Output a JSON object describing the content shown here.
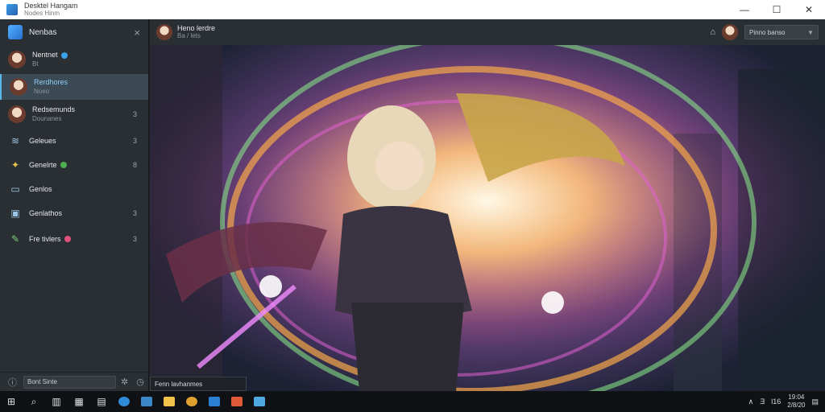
{
  "window": {
    "title": "Desktel Hangam",
    "subtitle": "Nodes   Hinm",
    "minimize_icon": "minimize-icon",
    "maximize_icon": "maximize-icon",
    "close_icon": "close-icon"
  },
  "sidebar": {
    "title": "Nenbas",
    "close_label": "×",
    "items": [
      {
        "label": "Nentnet",
        "sub": "Bt",
        "icon": "avatar",
        "badge_color": "#3aa0e8",
        "count": ""
      },
      {
        "label": "Rerdhores",
        "sub": "Noeo",
        "icon": "avatar",
        "badge_color": "",
        "count": "",
        "active": true
      },
      {
        "label": "Redsemunds",
        "sub": "Dounanes",
        "icon": "avatar",
        "badge_color": "",
        "count": "3"
      },
      {
        "label": "Geleues",
        "sub": "",
        "icon": "layers-icon",
        "badge_color": "",
        "count": "3"
      },
      {
        "label": "Genelrte",
        "sub": "",
        "icon": "puzzle-icon",
        "badge_color": "#4caf50",
        "count": "8"
      },
      {
        "label": "Genlos",
        "sub": "",
        "icon": "monitor-icon",
        "badge_color": "",
        "count": ""
      },
      {
        "label": "Genlathos",
        "sub": "",
        "icon": "image-icon",
        "badge_color": "",
        "count": "3"
      },
      {
        "label": "Fre tivlers",
        "sub": "",
        "icon": "brush-icon",
        "badge_color": "#e0507a",
        "count": "3"
      }
    ],
    "footer": {
      "search_value": "Bont Sinte"
    }
  },
  "main_header": {
    "name": "Heno lerdre",
    "sub": "Ba  /  lets",
    "select_value": "Pinno banso"
  },
  "viewer": {
    "caption": "Fenn lavhanmes"
  },
  "taskbar": {
    "tray_text_1": "Ǝ",
    "tray_text_2": "l16",
    "clock_time": "19:04",
    "clock_date": "2/8/20"
  }
}
